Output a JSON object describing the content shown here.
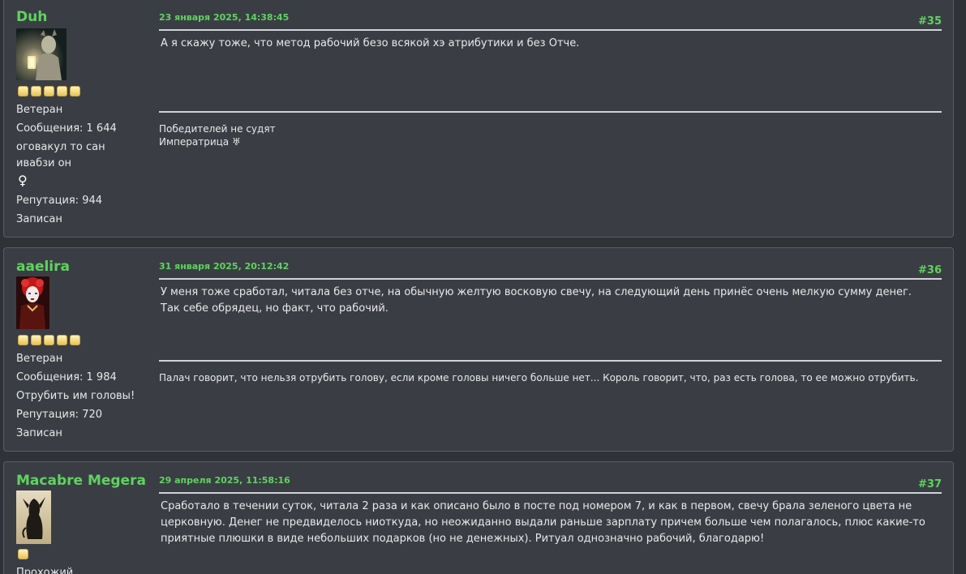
{
  "posts": [
    {
      "username": "Duh",
      "rank_stars": 5,
      "rank": "Ветеран",
      "messages": "Сообщения: 1 644",
      "custom_status_line1": "оговакул то сан",
      "custom_status_line2": "ивабзи он",
      "gender_symbol": "♀",
      "reputation": "Репутация: 944",
      "registered": "Записан",
      "date": "23 января 2025, 14:38:45",
      "number": "#35",
      "message": "А я скажу тоже, что метод рабочий безо всякой хэ атрибутики и без Отче.",
      "signature_line1": "Победителей не судят",
      "signature_line2": "Императрица ♅"
    },
    {
      "username": "aaelira",
      "rank_stars": 5,
      "rank": "Ветеран",
      "messages": "Сообщения: 1 984",
      "custom_status": "Отрубить им головы!",
      "reputation": "Репутация: 720",
      "registered": "Записан",
      "date": "31 января 2025, 20:12:42",
      "number": "#36",
      "message_line1": "У меня тоже сработал, читала без отче, на обычную желтую восковую свечу, на следующий день принёс очень мелкую сумму денег.",
      "message_line2": "Так себе обрядец, но факт, что рабочий.",
      "signature": "Палач говорит, что нельзя отрубить голову, если кроме головы ничего больше нет... Король говорит, что, раз есть голова, то ее можно отрубить."
    },
    {
      "username": "Macabre Megera",
      "rank_stars": 1,
      "rank": "Прохожий",
      "date": "29 апреля 2025, 11:58:16",
      "number": "#37",
      "message": "Сработало в течении суток, читала 2 раза и как описано было в посте под номером 7, и как в первом, свечу брала зеленого цвета не церковную. Денег не предвиделось ниоткуда, но неожиданно выдали раньше зарплату причем больше чем полагалось, плюс какие-то приятные плюшки в виде небольших подарков (но не денежных). Ритуал однозначно рабочий, благодарю!"
    }
  ],
  "colors": {
    "background": "#2f3338",
    "post_background": "#3a3e44",
    "accent_green": "#5fd35f",
    "text": "#e8e8e8"
  }
}
